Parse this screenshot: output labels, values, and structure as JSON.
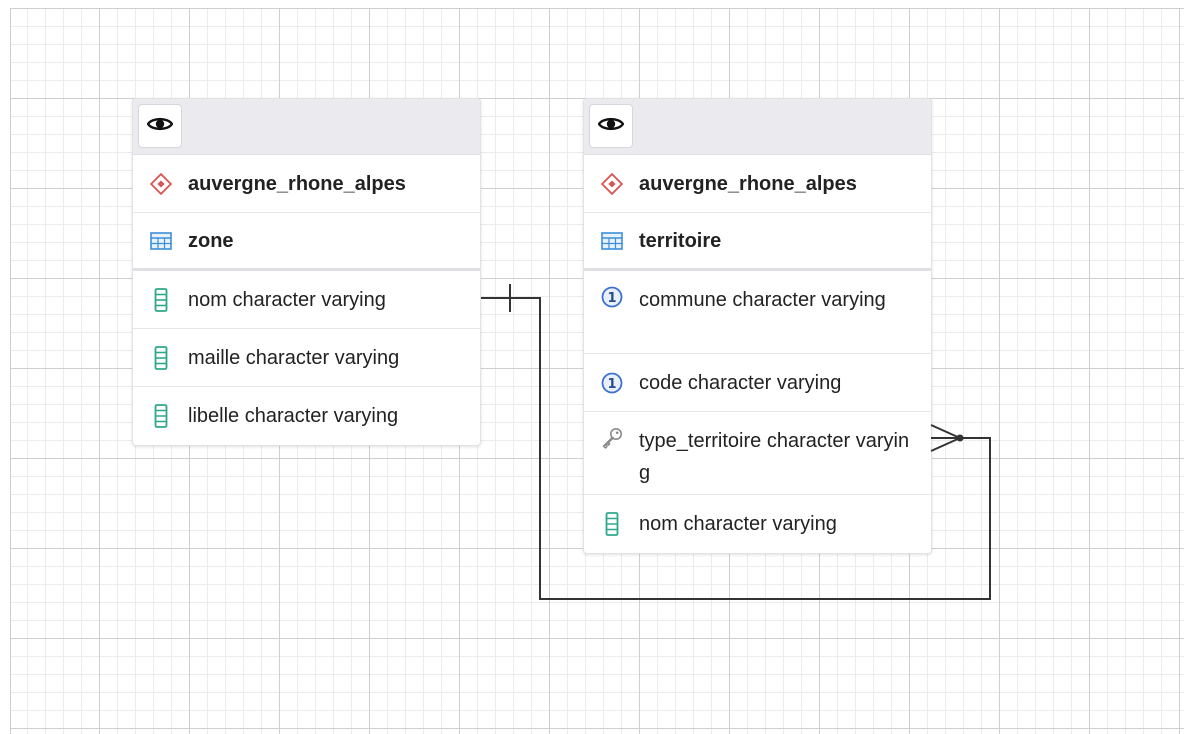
{
  "tables": [
    {
      "schema": "auvergne_rhone_alpes",
      "name": "zone",
      "columns": [
        {
          "label": "nom character varying",
          "icon": "column-icon"
        },
        {
          "label": "maille character varying",
          "icon": "column-icon"
        },
        {
          "label": "libelle character varying",
          "icon": "column-icon"
        }
      ]
    },
    {
      "schema": "auvergne_rhone_alpes",
      "name": "territoire",
      "columns": [
        {
          "label": "commune character varying",
          "icon": "unique-constraint-icon"
        },
        {
          "label": "code character varying",
          "icon": "unique-constraint-icon"
        },
        {
          "label": "type_territoire character varying",
          "icon": "foreign-key-icon"
        },
        {
          "label": "nom character varying",
          "icon": "column-icon"
        }
      ]
    }
  ],
  "relationship": {
    "from": "territoire.type_territoire",
    "to": "zone.nom",
    "from_cardinality": "many",
    "to_cardinality": "one"
  },
  "colors": {
    "schema_icon": "#d9534f",
    "table_icon": "#3b8fd9",
    "column_icon": "#2ea889",
    "unique_icon": "#3b6fd0",
    "key_icon": "#8a8a8a",
    "link": "#333333"
  }
}
